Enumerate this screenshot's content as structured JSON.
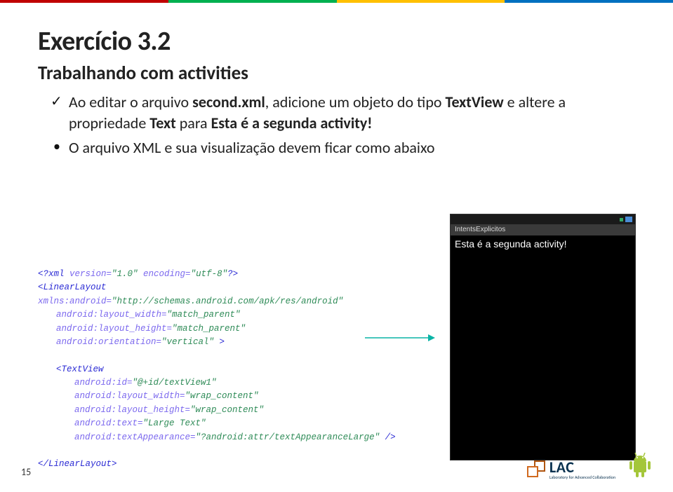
{
  "title": "Exercício 3.2",
  "subtitle": "Trabalhando com activities",
  "bullets": {
    "b1_pre": "Ao editar o arquivo ",
    "b1_file": "second.xml",
    "b1_mid": ", adicione um objeto do tipo ",
    "b1_tv": "TextView",
    "b1_post1": " e altere a propriedade ",
    "b1_prop": "Text",
    "b1_post2": " para ",
    "b1_val": "Esta é a segunda activity!",
    "b2": "O arquivo XML e sua visualização devem ficar como abaixo"
  },
  "code": {
    "l1a": "<?xml ",
    "l1b": "version=",
    "l1c": "\"1.0\" ",
    "l1d": "encoding=",
    "l1e": "\"utf-8\"",
    "l1f": "?>",
    "l2a": "<LinearLayout ",
    "l2b": "xmlns:android=",
    "l2c": "\"http://schemas.android.com/apk/res/android\"",
    "l3a": "android:layout_width=",
    "l3b": "\"match_parent\"",
    "l4a": "android:layout_height=",
    "l4b": "\"match_parent\"",
    "l5a": "android:orientation=",
    "l5b": "\"vertical\" ",
    "l5c": ">",
    "l6a": "<TextView",
    "l7a": "android:id=",
    "l7b": "\"@+id/textView1\"",
    "l8a": "android:layout_width=",
    "l8b": "\"wrap_content\"",
    "l9a": "android:layout_height=",
    "l9b": "\"wrap_content\"",
    "l10a": "android:text=",
    "l10b": "\"Large Text\"",
    "l11a": "android:textAppearance=",
    "l11b": "\"?android:attr/textAppearanceLarge\" ",
    "l11c": "/>",
    "l12": "</LinearLayout>"
  },
  "phone": {
    "appTitle": "IntentsExplicitos",
    "textView": "Esta é a segunda activity!"
  },
  "footer": {
    "pageNumber": "15",
    "lacBig": "LAC",
    "lacSmall": "Laboratory for Advanced Collaboration"
  }
}
